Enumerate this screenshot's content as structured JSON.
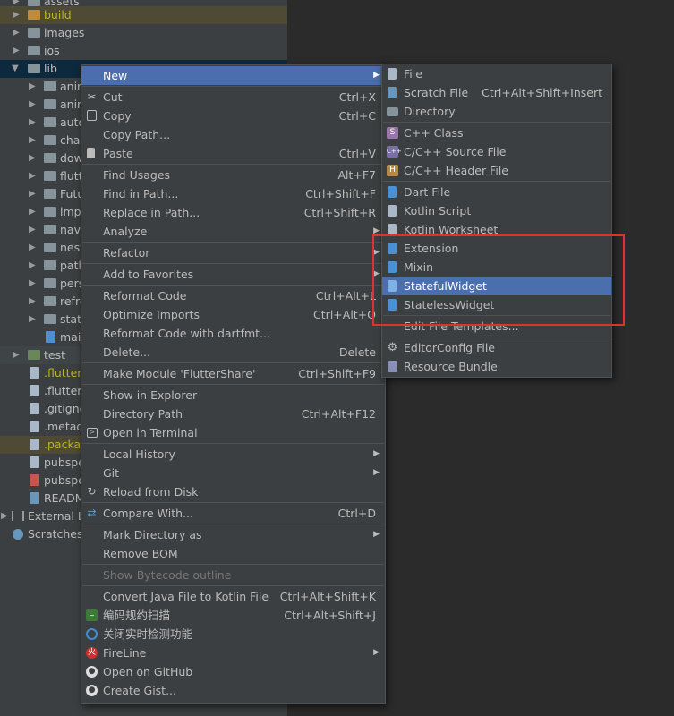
{
  "tree": {
    "rows": [
      {
        "label": "assets",
        "depth": 1
      },
      {
        "label": "build",
        "depth": 1
      },
      {
        "label": "images",
        "depth": 1
      },
      {
        "label": "ios",
        "depth": 1
      },
      {
        "label": "lib",
        "depth": 1
      },
      {
        "label": "anin",
        "depth": 2
      },
      {
        "label": "anin",
        "depth": 2
      },
      {
        "label": "auto",
        "depth": 2
      },
      {
        "label": "char",
        "depth": 2
      },
      {
        "label": "dow",
        "depth": 2
      },
      {
        "label": "flutt",
        "depth": 2
      },
      {
        "label": "Futu",
        "depth": 2
      },
      {
        "label": "imp",
        "depth": 2
      },
      {
        "label": "navi",
        "depth": 2
      },
      {
        "label": "nest",
        "depth": 2
      },
      {
        "label": "path",
        "depth": 2
      },
      {
        "label": "pers",
        "depth": 2
      },
      {
        "label": "refre",
        "depth": 2
      },
      {
        "label": "state",
        "depth": 2
      },
      {
        "label": "main",
        "depth": 2
      },
      {
        "label": "test",
        "depth": 1
      },
      {
        "label": ".flutter-",
        "depth": 1
      },
      {
        "label": ".flutter-",
        "depth": 1
      },
      {
        "label": ".gitignc",
        "depth": 1
      },
      {
        "label": ".metad",
        "depth": 1
      },
      {
        "label": ".packag",
        "depth": 1
      },
      {
        "label": "pubspe",
        "depth": 1
      },
      {
        "label": "pubspe",
        "depth": 1
      },
      {
        "label": "READM",
        "depth": 1
      },
      {
        "label": "External Li",
        "depth": 0
      },
      {
        "label": "Scratches",
        "depth": 0
      }
    ]
  },
  "context_menu": {
    "items": [
      {
        "label": "New",
        "shortcut": ""
      },
      {
        "label": "Cut",
        "shortcut": "Ctrl+X"
      },
      {
        "label": "Copy",
        "shortcut": "Ctrl+C"
      },
      {
        "label": "Copy Path...",
        "shortcut": ""
      },
      {
        "label": "Paste",
        "shortcut": "Ctrl+V"
      },
      {
        "label": "Find Usages",
        "shortcut": "Alt+F7"
      },
      {
        "label": "Find in Path...",
        "shortcut": "Ctrl+Shift+F"
      },
      {
        "label": "Replace in Path...",
        "shortcut": "Ctrl+Shift+R"
      },
      {
        "label": "Analyze",
        "shortcut": ""
      },
      {
        "label": "Refactor",
        "shortcut": ""
      },
      {
        "label": "Add to Favorites",
        "shortcut": ""
      },
      {
        "label": "Reformat Code",
        "shortcut": "Ctrl+Alt+L"
      },
      {
        "label": "Optimize Imports",
        "shortcut": "Ctrl+Alt+O"
      },
      {
        "label": "Reformat Code with dartfmt...",
        "shortcut": ""
      },
      {
        "label": "Delete...",
        "shortcut": "Delete"
      },
      {
        "label": "Make Module 'FlutterShare'",
        "shortcut": "Ctrl+Shift+F9"
      },
      {
        "label": "Show in Explorer",
        "shortcut": ""
      },
      {
        "label": "Directory Path",
        "shortcut": "Ctrl+Alt+F12"
      },
      {
        "label": "Open in Terminal",
        "shortcut": ""
      },
      {
        "label": "Local History",
        "shortcut": ""
      },
      {
        "label": "Git",
        "shortcut": ""
      },
      {
        "label": "Reload from Disk",
        "shortcut": ""
      },
      {
        "label": "Compare With...",
        "shortcut": "Ctrl+D"
      },
      {
        "label": "Mark Directory as",
        "shortcut": ""
      },
      {
        "label": "Remove BOM",
        "shortcut": ""
      },
      {
        "label": "Show Bytecode outline",
        "shortcut": ""
      },
      {
        "label": "Convert Java File to Kotlin File",
        "shortcut": "Ctrl+Alt+Shift+K"
      },
      {
        "label": "编码规约扫描",
        "shortcut": "Ctrl+Alt+Shift+J"
      },
      {
        "label": "关闭实时检测功能",
        "shortcut": ""
      },
      {
        "label": "FireLine",
        "shortcut": ""
      },
      {
        "label": "Open on GitHub",
        "shortcut": ""
      },
      {
        "label": "Create Gist...",
        "shortcut": ""
      }
    ]
  },
  "new_submenu": {
    "items": [
      {
        "label": "File",
        "shortcut": ""
      },
      {
        "label": "Scratch File",
        "shortcut": "Ctrl+Alt+Shift+Insert"
      },
      {
        "label": "Directory",
        "shortcut": ""
      },
      {
        "label": "C++ Class",
        "shortcut": ""
      },
      {
        "label": "C/C++ Source File",
        "shortcut": ""
      },
      {
        "label": "C/C++ Header File",
        "shortcut": ""
      },
      {
        "label": "Dart File",
        "shortcut": ""
      },
      {
        "label": "Kotlin Script",
        "shortcut": ""
      },
      {
        "label": "Kotlin Worksheet",
        "shortcut": ""
      },
      {
        "label": "Extension",
        "shortcut": ""
      },
      {
        "label": "Mixin",
        "shortcut": ""
      },
      {
        "label": "StatefulWidget",
        "shortcut": ""
      },
      {
        "label": "StatelessWidget",
        "shortcut": ""
      },
      {
        "label": "Edit File Templates...",
        "shortcut": ""
      },
      {
        "label": "EditorConfig File",
        "shortcut": ""
      },
      {
        "label": "Resource Bundle",
        "shortcut": ""
      }
    ]
  },
  "colors": {
    "accent": "#4b6eaf",
    "highlight_box": "#e0302f",
    "background": "#3c3f41"
  }
}
